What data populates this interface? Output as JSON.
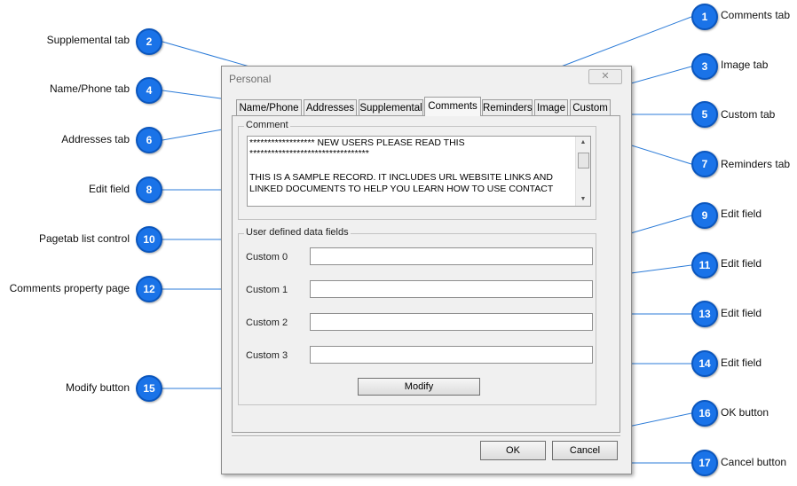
{
  "dialog": {
    "title": "Personal",
    "close_glyph": "✕",
    "tabs": [
      "Name/Phone",
      "Addresses",
      "Supplemental",
      "Comments",
      "Reminders",
      "Image",
      "Custom"
    ],
    "active_tab": "Comments",
    "comment_group_label": "Comment",
    "comment_lines": [
      "******************  NEW USERS PLEASE READ THIS",
      "*********************************",
      "",
      "THIS IS A SAMPLE RECORD. IT INCLUDES URL WEBSITE  LINKS AND",
      "LINKED DOCUMENTS TO HELP YOU LEARN HOW TO USE CONTACT"
    ],
    "user_group_label": "User defined data fields",
    "custom_fields": [
      {
        "label": "Custom 0",
        "value": ""
      },
      {
        "label": "Custom 1",
        "value": ""
      },
      {
        "label": "Custom 2",
        "value": ""
      },
      {
        "label": "Custom 3",
        "value": ""
      }
    ],
    "modify_label": "Modify",
    "ok_label": "OK",
    "cancel_label": "Cancel"
  },
  "callouts": [
    {
      "num": "1",
      "label": "Comments tab"
    },
    {
      "num": "2",
      "label": "Supplemental tab"
    },
    {
      "num": "3",
      "label": "Image tab"
    },
    {
      "num": "4",
      "label": "Name/Phone tab"
    },
    {
      "num": "5",
      "label": "Custom tab"
    },
    {
      "num": "6",
      "label": "Addresses tab"
    },
    {
      "num": "7",
      "label": "Reminders tab"
    },
    {
      "num": "8",
      "label": "Edit field"
    },
    {
      "num": "9",
      "label": "Edit field"
    },
    {
      "num": "10",
      "label": "Pagetab list control"
    },
    {
      "num": "11",
      "label": "Edit field"
    },
    {
      "num": "12",
      "label": "Comments property page"
    },
    {
      "num": "13",
      "label": "Edit field"
    },
    {
      "num": "14",
      "label": "Edit field"
    },
    {
      "num": "15",
      "label": "Modify button"
    },
    {
      "num": "16",
      "label": "OK button"
    },
    {
      "num": "17",
      "label": "Cancel button"
    }
  ],
  "colors": {
    "callout": "#1a73e8",
    "leader_line": "#2b7bd8",
    "dialog_bg": "#f0f0f0"
  }
}
